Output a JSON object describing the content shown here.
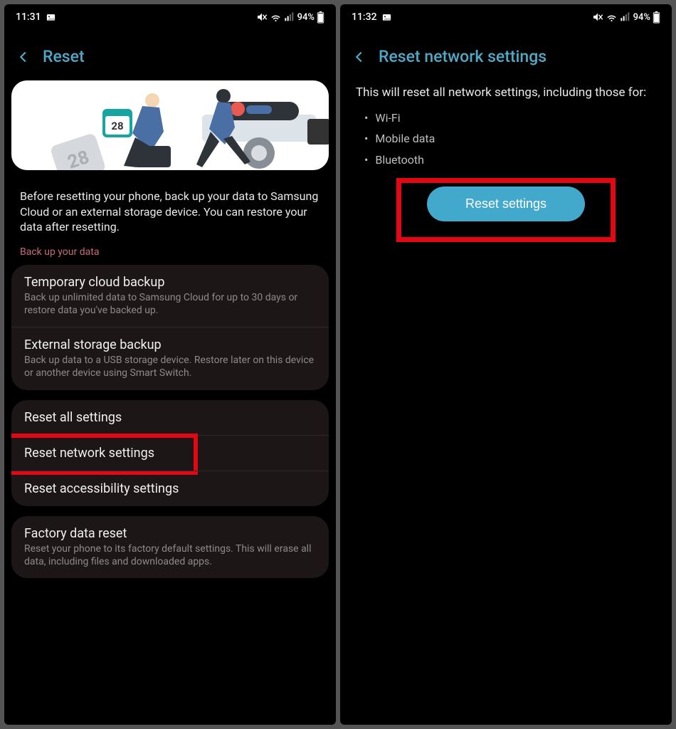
{
  "left": {
    "status": {
      "time": "11:31",
      "battery": "94%"
    },
    "header": "Reset",
    "calendar_day": "28",
    "info": "Before resetting your phone, back up your data to Samsung Cloud or an external storage device. You can restore your data after resetting.",
    "section_label": "Back up your data",
    "backup": {
      "cloud": {
        "title": "Temporary cloud backup",
        "sub": "Back up unlimited data to Samsung Cloud for up to 30 days or restore data you've backed up."
      },
      "ext": {
        "title": "External storage backup",
        "sub": "Back up data to a USB storage device. Restore later on this device or another device using Smart Switch."
      }
    },
    "resets": {
      "all": "Reset all settings",
      "net": "Reset network settings",
      "acc": "Reset accessibility settings"
    },
    "factory": {
      "title": "Factory data reset",
      "sub": "Reset your phone to its factory default settings. This will erase all data, including files and downloaded apps."
    }
  },
  "right": {
    "status": {
      "time": "11:32",
      "battery": "94%"
    },
    "header": "Reset network settings",
    "desc": "This will reset all network settings, including those for:",
    "bullets": {
      "b1": "Wi-Fi",
      "b2": "Mobile data",
      "b3": "Bluetooth"
    },
    "button": "Reset settings"
  }
}
